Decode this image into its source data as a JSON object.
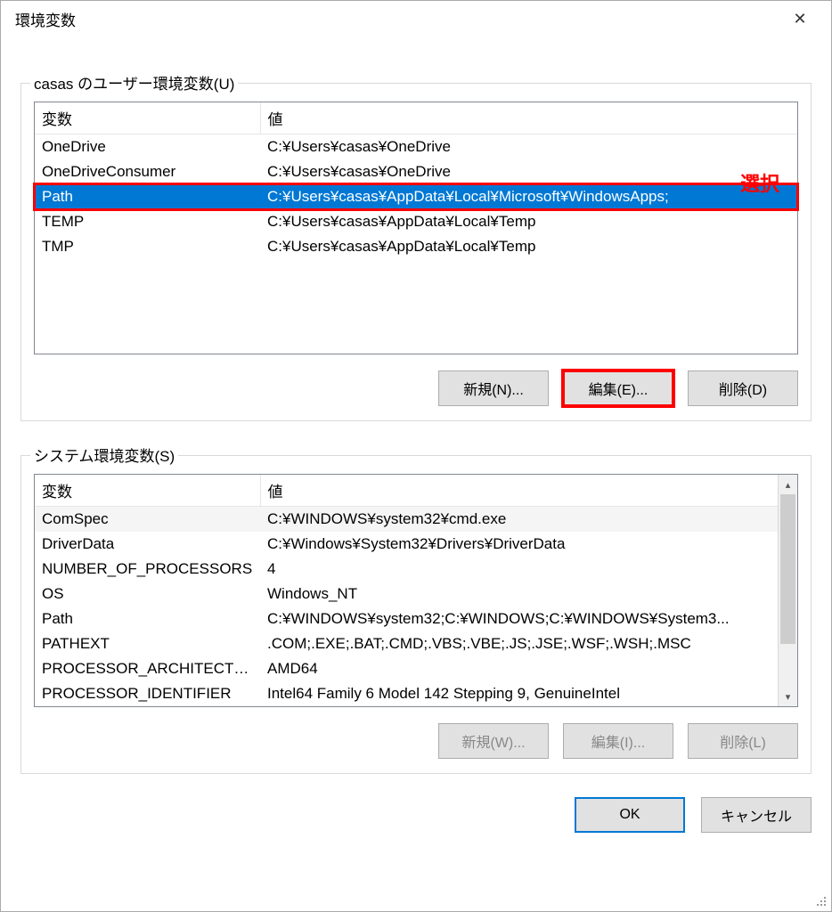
{
  "window": {
    "title": "環境変数"
  },
  "annotation": {
    "select_label": "選択"
  },
  "user_section": {
    "title": "casas のユーザー環境変数(U)",
    "col_var": "変数",
    "col_val": "値",
    "rows": [
      {
        "name": "OneDrive",
        "value": "C:¥Users¥casas¥OneDrive"
      },
      {
        "name": "OneDriveConsumer",
        "value": "C:¥Users¥casas¥OneDrive"
      },
      {
        "name": "Path",
        "value": "C:¥Users¥casas¥AppData¥Local¥Microsoft¥WindowsApps;"
      },
      {
        "name": "TEMP",
        "value": "C:¥Users¥casas¥AppData¥Local¥Temp"
      },
      {
        "name": "TMP",
        "value": "C:¥Users¥casas¥AppData¥Local¥Temp"
      }
    ],
    "buttons": {
      "new_": "新規(N)...",
      "edit": "編集(E)...",
      "delete_": "削除(D)"
    }
  },
  "system_section": {
    "title": "システム環境変数(S)",
    "col_var": "変数",
    "col_val": "値",
    "rows": [
      {
        "name": "ComSpec",
        "value": "C:¥WINDOWS¥system32¥cmd.exe"
      },
      {
        "name": "DriverData",
        "value": "C:¥Windows¥System32¥Drivers¥DriverData"
      },
      {
        "name": "NUMBER_OF_PROCESSORS",
        "value": "4"
      },
      {
        "name": "OS",
        "value": "Windows_NT"
      },
      {
        "name": "Path",
        "value": "C:¥WINDOWS¥system32;C:¥WINDOWS;C:¥WINDOWS¥System3..."
      },
      {
        "name": "PATHEXT",
        "value": ".COM;.EXE;.BAT;.CMD;.VBS;.VBE;.JS;.JSE;.WSF;.WSH;.MSC"
      },
      {
        "name": "PROCESSOR_ARCHITECTURE",
        "value": "AMD64"
      },
      {
        "name": "PROCESSOR_IDENTIFIER",
        "value": "Intel64 Family 6 Model 142 Stepping 9, GenuineIntel"
      }
    ],
    "buttons": {
      "new_": "新規(W)...",
      "edit": "編集(I)...",
      "delete_": "削除(L)"
    }
  },
  "dialog": {
    "ok": "OK",
    "cancel": "キャンセル"
  }
}
